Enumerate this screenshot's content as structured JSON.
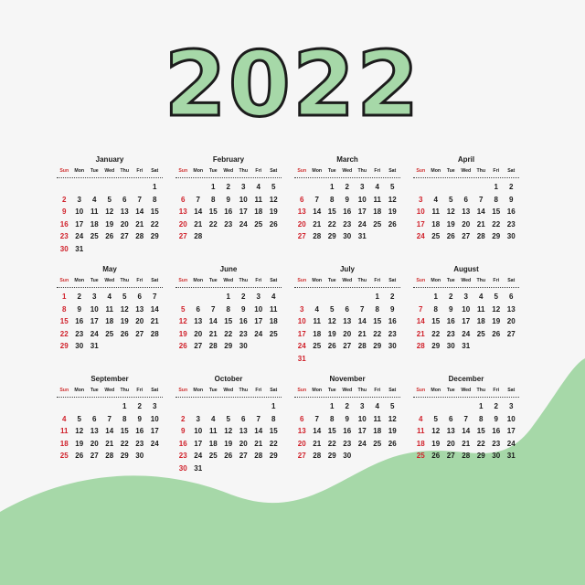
{
  "year": "2022",
  "weekdays": [
    "Sun",
    "Mon",
    "Tue",
    "Wed",
    "Thu",
    "Fri",
    "Sat"
  ],
  "colors": {
    "accent_green": "#a6d8a8",
    "sunday_red": "#d0202a",
    "text": "#1a1a1a",
    "background": "#f6f6f6"
  },
  "months": [
    {
      "name": "January",
      "start": 6,
      "days": 31
    },
    {
      "name": "February",
      "start": 2,
      "days": 28
    },
    {
      "name": "March",
      "start": 2,
      "days": 31
    },
    {
      "name": "April",
      "start": 5,
      "days": 30
    },
    {
      "name": "May",
      "start": 0,
      "days": 31
    },
    {
      "name": "June",
      "start": 3,
      "days": 30
    },
    {
      "name": "July",
      "start": 5,
      "days": 31
    },
    {
      "name": "August",
      "start": 1,
      "days": 31
    },
    {
      "name": "September",
      "start": 4,
      "days": 30
    },
    {
      "name": "October",
      "start": 6,
      "days": 31
    },
    {
      "name": "November",
      "start": 2,
      "days": 30
    },
    {
      "name": "December",
      "start": 4,
      "days": 31
    }
  ]
}
